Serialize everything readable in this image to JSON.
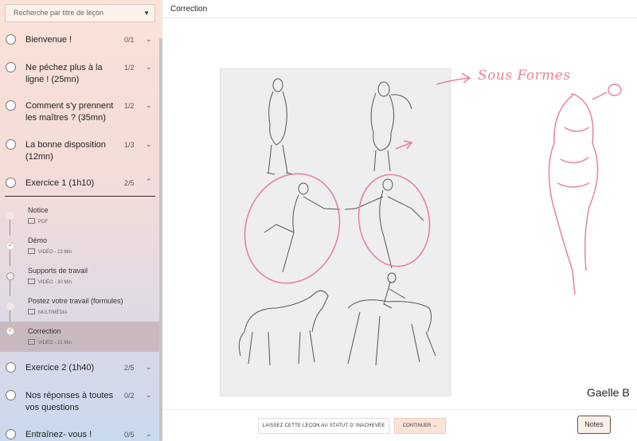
{
  "sidebar": {
    "search_placeholder": "Recherche par titre de leçon",
    "lessons": [
      {
        "title": "Bienvenue !",
        "count": "0/1",
        "expanded": false
      },
      {
        "title": "Ne péchez plus à la ligne ! (25mn)",
        "count": "1/2",
        "expanded": false
      },
      {
        "title": "Comment s'y prennent les maîtres ? (35mn)",
        "count": "1/2",
        "expanded": false
      },
      {
        "title": "La bonne disposition (12mn)",
        "count": "1/3",
        "expanded": false
      },
      {
        "title": "Exercice 1 (1h10)",
        "count": "2/5",
        "expanded": true
      },
      {
        "title": "Exercice 2 (1h40)",
        "count": "2/5",
        "expanded": false
      },
      {
        "title": "Nos réponses à toutes vos questions",
        "count": "0/2",
        "expanded": false
      },
      {
        "title": "Entraînez- vous !",
        "count": "0/5",
        "expanded": false
      }
    ],
    "sub_items": [
      {
        "title": "Notice",
        "meta": "PDF",
        "status": "faint",
        "icon": "pdf-icon"
      },
      {
        "title": "Démo",
        "meta": "VIDÉO - 23 Min",
        "status": "done",
        "icon": "video-icon"
      },
      {
        "title": "Supports de travail",
        "meta": "VIDÉO - 30 Min",
        "status": "empty",
        "icon": "video-icon"
      },
      {
        "title": "Postez votre travail (formules)",
        "meta": "MULTIMÉDIA",
        "status": "faint",
        "icon": "multimedia-icon"
      },
      {
        "title": "Correction",
        "meta": "VIDÉO - 21 Min",
        "status": "done",
        "icon": "video-icon",
        "active": true
      }
    ]
  },
  "main": {
    "title": "Correction",
    "annotation_text": "Sous Formes",
    "artist_name": "Gaelle B"
  },
  "footer": {
    "incomplete_label": "LAISSEZ CETTE LEÇON AU STATUT D' INACHEVÉE",
    "continue_label": "CONTINUER →",
    "notes_label": "Notes"
  },
  "colors": {
    "annotation_pink": "#e8829a",
    "active_row": "#c8b9c0",
    "check_orange": "#b4742e"
  }
}
